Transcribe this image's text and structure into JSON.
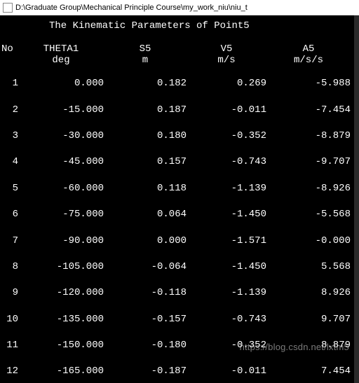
{
  "window": {
    "title": "D:\\Graduate Group\\Mechanical Principle Course\\my_work_niu\\niu_t"
  },
  "console": {
    "title": "The Kinematic Parameters of Point5",
    "headers": {
      "no": "No",
      "theta": "THETA1",
      "s5": "S5",
      "v5": "V5",
      "a5": "A5"
    },
    "units": {
      "theta": "deg",
      "s5": "m",
      "v5": "m/s",
      "a5": "m/s/s"
    },
    "rows": [
      {
        "no": "1",
        "theta": "0.000",
        "s5": "0.182",
        "v5": "0.269",
        "a5": "-5.988"
      },
      {
        "no": "2",
        "theta": "-15.000",
        "s5": "0.187",
        "v5": "-0.011",
        "a5": "-7.454"
      },
      {
        "no": "3",
        "theta": "-30.000",
        "s5": "0.180",
        "v5": "-0.352",
        "a5": "-8.879"
      },
      {
        "no": "4",
        "theta": "-45.000",
        "s5": "0.157",
        "v5": "-0.743",
        "a5": "-9.707"
      },
      {
        "no": "5",
        "theta": "-60.000",
        "s5": "0.118",
        "v5": "-1.139",
        "a5": "-8.926"
      },
      {
        "no": "6",
        "theta": "-75.000",
        "s5": "0.064",
        "v5": "-1.450",
        "a5": "-5.568"
      },
      {
        "no": "7",
        "theta": "-90.000",
        "s5": "0.000",
        "v5": "-1.571",
        "a5": "-0.000"
      },
      {
        "no": "8",
        "theta": "-105.000",
        "s5": "-0.064",
        "v5": "-1.450",
        "a5": "5.568"
      },
      {
        "no": "9",
        "theta": "-120.000",
        "s5": "-0.118",
        "v5": "-1.139",
        "a5": "8.926"
      },
      {
        "no": "10",
        "theta": "-135.000",
        "s5": "-0.157",
        "v5": "-0.743",
        "a5": "9.707"
      },
      {
        "no": "11",
        "theta": "-150.000",
        "s5": "-0.180",
        "v5": "-0.352",
        "a5": "8.879"
      },
      {
        "no": "12",
        "theta": "-165.000",
        "s5": "-0.187",
        "v5": "-0.011",
        "a5": "7.454"
      }
    ]
  },
  "watermark": "https://blog.csdn.net/lxtm5"
}
